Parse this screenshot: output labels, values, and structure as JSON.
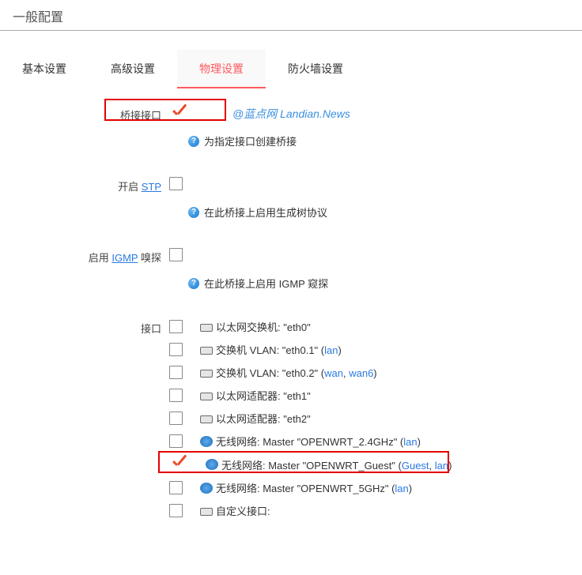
{
  "title": "一般配置",
  "tabs": [
    {
      "label": "基本设置"
    },
    {
      "label": "高级设置"
    },
    {
      "label": "物理设置",
      "active": true
    },
    {
      "label": "防火墙设置"
    }
  ],
  "watermark": "@蓝点网 Landian.News",
  "bridge": {
    "label": "桥接接口",
    "checked": true,
    "help": "为指定接口创建桥接"
  },
  "stp": {
    "label_prefix": "开启 ",
    "label_link": "STP",
    "checked": false,
    "help": "在此桥接上启用生成树协议"
  },
  "igmp": {
    "label_prefix": "启用 ",
    "label_link": "IGMP",
    "label_suffix": " 嗅探",
    "checked": false,
    "help": "在此桥接上启用 IGMP 窥探"
  },
  "interfaces_label": "接口",
  "interfaces": [
    {
      "icon": "eth",
      "text_pre": "以太网交换机: \"eth0\"",
      "nets": []
    },
    {
      "icon": "eth",
      "text_pre": "交换机 VLAN: \"eth0.1\" (",
      "nets": [
        "lan"
      ],
      "text_post": ")"
    },
    {
      "icon": "eth",
      "text_pre": "交换机 VLAN: \"eth0.2\" (",
      "nets": [
        "wan",
        "wan6"
      ],
      "text_post": ")"
    },
    {
      "icon": "eth",
      "text_pre": "以太网适配器: \"eth1\"",
      "nets": []
    },
    {
      "icon": "eth",
      "text_pre": "以太网适配器: \"eth2\"",
      "nets": []
    },
    {
      "icon": "wifi",
      "text_pre": "无线网络: Master \"OPENWRT_2.4GHz\" (",
      "nets": [
        "lan"
      ],
      "text_post": ")"
    },
    {
      "icon": "wifi",
      "text_pre": "无线网络: Master \"OPENWRT_Guest\" (",
      "nets": [
        "Guest",
        "lan"
      ],
      "text_post": ")",
      "checked": true,
      "highlight": true
    },
    {
      "icon": "wifi",
      "text_pre": "无线网络: Master \"OPENWRT_5GHz\" (",
      "nets": [
        "lan"
      ],
      "text_post": ")"
    },
    {
      "icon": "eth",
      "text_pre": "自定义接口:",
      "nets": []
    }
  ]
}
